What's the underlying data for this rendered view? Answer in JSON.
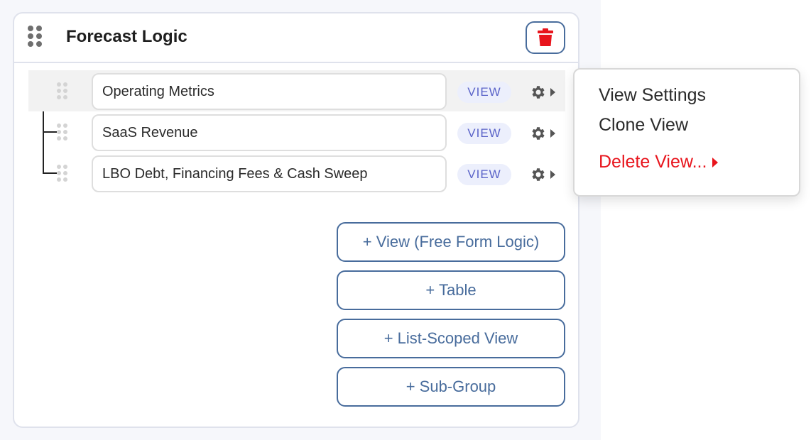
{
  "group": {
    "title": "Forecast Logic",
    "delete_icon": "trash-icon",
    "drag_icon": "drag-handle-icon"
  },
  "views": [
    {
      "name": "Operating Metrics",
      "badge": "VIEW",
      "hovered": true
    },
    {
      "name": "SaaS Revenue",
      "badge": "VIEW",
      "hovered": false
    },
    {
      "name": "LBO Debt, Financing Fees & Cash Sweep",
      "badge": "VIEW",
      "hovered": false
    }
  ],
  "add_buttons": {
    "view": "+ View (Free Form Logic)",
    "table": "+ Table",
    "list_scoped": "+ List-Scoped View",
    "sub_group": "+ Sub-Group"
  },
  "context_menu": {
    "view_settings": "View Settings",
    "clone_view": "Clone View",
    "delete_view": "Delete View..."
  },
  "colors": {
    "accent": "#486c9c",
    "danger": "#e8141c",
    "badge_bg": "#eceffc",
    "badge_text": "#5a63c8"
  }
}
